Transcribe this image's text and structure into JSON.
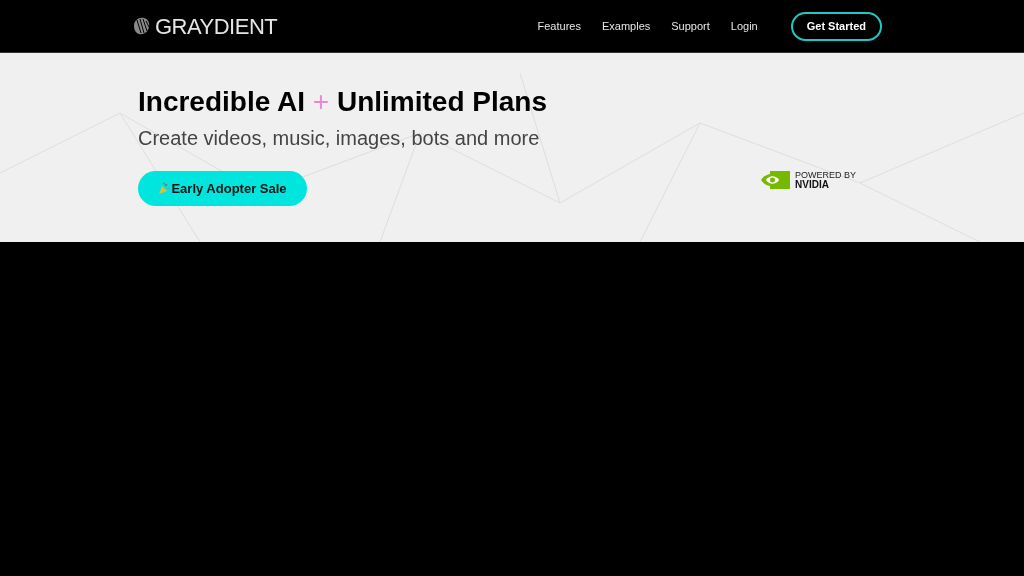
{
  "header": {
    "logo_text": "GRAYDIENT",
    "nav": [
      "Features",
      "Examples",
      "Support",
      "Login"
    ],
    "cta": "Get Started"
  },
  "hero": {
    "headline": {
      "before": "Incredible AI",
      "accent": "+",
      "after": "Unlimited Plans"
    },
    "subtitle": "Create videos, music, images, bots and more",
    "button": "Early Adopter Sale",
    "badge": {
      "line_1": "POWERED BY",
      "line_2": "NVIDIA"
    }
  }
}
